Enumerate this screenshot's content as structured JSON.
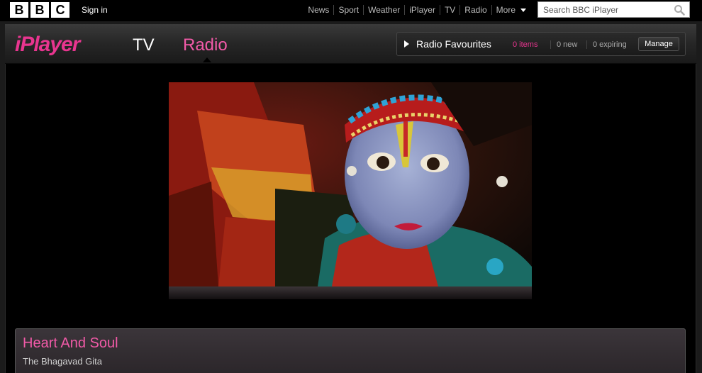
{
  "bbc": {
    "logo_letters": [
      "B",
      "B",
      "C"
    ],
    "sign_in": "Sign in",
    "nav": [
      "News",
      "Sport",
      "Weather",
      "iPlayer",
      "TV",
      "Radio"
    ],
    "more": "More",
    "search_placeholder": "Search BBC iPlayer"
  },
  "iplayer": {
    "logo": "iPlayer",
    "tabs": {
      "tv": "TV",
      "radio": "Radio"
    },
    "active_tab": "Radio",
    "favourites": {
      "label": "Radio Favourites",
      "items": "0 items",
      "new": "0 new",
      "expiring": "0 expiring",
      "manage": "Manage"
    }
  },
  "featured": {
    "image": "child-in-krishna-costume-portrait",
    "title": "Heart And Soul",
    "subtitle": "The Bhagavad Gita"
  },
  "colors": {
    "accent_pink": "#e8358f",
    "active_tab": "#f25aa8",
    "background": "#000000"
  }
}
